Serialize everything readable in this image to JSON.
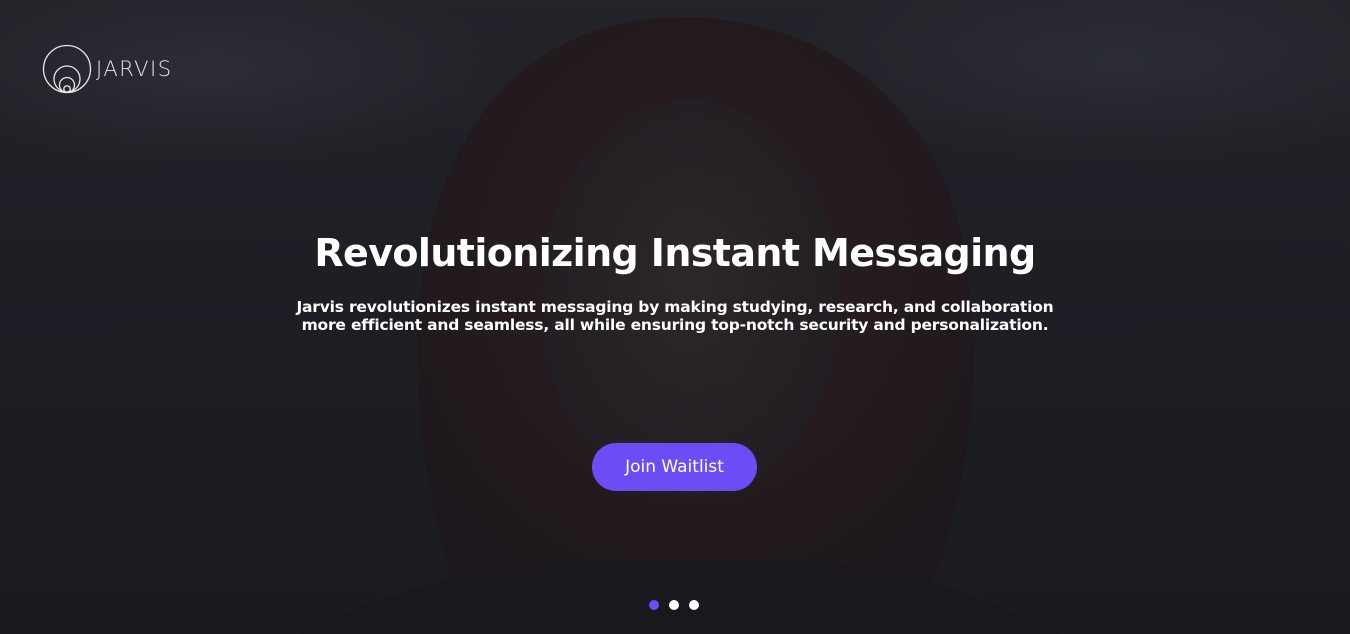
{
  "brand": {
    "name": "JARVIS",
    "logo_icon": "concentric-circles-logo"
  },
  "hero": {
    "title": "Revolutionizing Instant Messaging",
    "subtitle": "Jarvis revolutionizes instant messaging by making studying, research, and collaboration more efficient and seamless, all while ensuring top-notch security and personalization.",
    "cta_label": "Join Waitlist"
  },
  "carousel": {
    "slide_count": 3,
    "active_index": 0
  },
  "colors": {
    "accent": "#6c4cf5",
    "text": "#ffffff",
    "dot_inactive": "#ffffff"
  }
}
